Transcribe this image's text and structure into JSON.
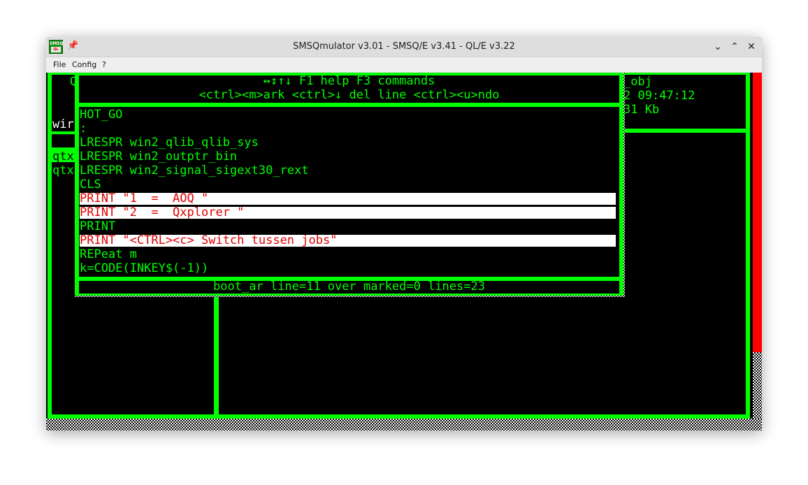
{
  "window": {
    "title": "SMSQmulator v3.01 - SMSQ/E v3.41 - QL/E v3.22",
    "icon_text_top": "SMSQ",
    "icon_text_bottom": "QL"
  },
  "menu": {
    "file": "File",
    "config": "Config",
    "help": "?"
  },
  "background": {
    "left_partial_top": "Q",
    "left_partial_win": "wir",
    "left_partial_qtx1": "qtx",
    "left_partial_qtx2": "qtx",
    "right_obj": "_obj",
    "right_time": "2 09:47:12",
    "right_kb": "31 Kb"
  },
  "editor": {
    "header_line1": "↔↕↑↓ F1 help F3 commands",
    "header_line2": "<ctrl><m>ark <ctrl>↓ del line <ctrl><u>ndo",
    "lines": [
      "HOT_GO",
      ":",
      "LRESPR win2_qlib_qlib_sys",
      "LRESPR win2_outptr_bin",
      "LRESPR win2_signal_sigext30_rext",
      "CLS",
      "PRINT \"1  =  AOQ \"",
      "PRINT \"2  =  Qxplorer \"",
      "PRINT",
      "PRINT \"<CTRL><c> Switch tussen jobs\"",
      "REPeat m",
      "k=CODE(INKEY$(-1))"
    ],
    "status": "boot_ar line=11 over marked=0 lines=23"
  },
  "colors": {
    "green": "#00ff00",
    "red": "#ff0000",
    "highlight_text": "#e00000"
  }
}
